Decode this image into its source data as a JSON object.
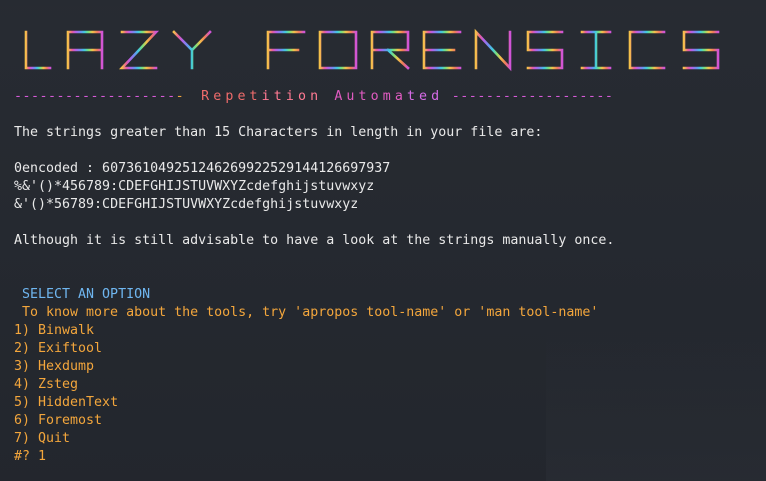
{
  "terminal": {
    "banner": "LAZY FORENSICS",
    "tagline_parts": [
      "Repet",
      "ition",
      "Automa",
      "ted"
    ],
    "divider_left": "-------------------",
    "divider_right": "-------------------",
    "intro": "The strings greater than 15 Characters in length in your file are:",
    "strings": [
      "0encoded : 607361049251246269922529144126697937",
      "%&'()*456789:CDEFGHIJSTUVWXYZcdefghijstuvwxyz",
      "&'()*56789:CDEFGHIJSTUVWXYZcdefghijstuvwxyz"
    ],
    "advice": "Although it is still advisable to have a look at the strings manually once.",
    "select_title": "SELECT AN OPTION",
    "tip": "To know more about the tools, try 'apropos tool-name' or 'man tool-name'",
    "menu": [
      "1) Binwalk",
      "2) Exiftool",
      "3) Hexdump",
      "4) Zsteg",
      "5) HiddenText",
      "6) Foremost",
      "7) Quit"
    ],
    "prompt": "#? 1"
  },
  "colors": {
    "background": "#24282f",
    "orange": "#f3a63c",
    "blue": "#6fb6f0",
    "magenta": "#c74bd6"
  }
}
